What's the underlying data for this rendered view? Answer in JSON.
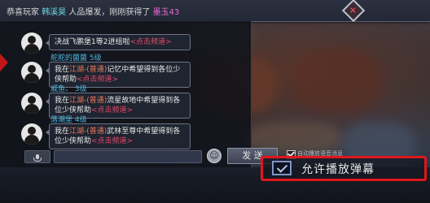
{
  "announcement": {
    "prefix": "恭喜玩家",
    "player": "韩溪昊",
    "middle": "人品爆发，刚刚获得了",
    "item": "墨玉43"
  },
  "chat": {
    "messages": [
      {
        "name": "",
        "text": "决战飞鹏堡1等2进组啦",
        "link": "<点击频道>"
      },
      {
        "name": "舵舵的菌菌 5级",
        "pre": "我在",
        "loc": "江湖-(普通)",
        "post": "记忆中希望得到各位少侠帮助",
        "link": "<点击频道>"
      },
      {
        "name": "戚鱼、 3级",
        "pre": "我在",
        "loc": "江湖-(普通)",
        "post": "流星故地中希望得到各位少侠帮助",
        "link": "<点击频道>"
      },
      {
        "name": "落潮堡 4级",
        "pre": "我在",
        "loc": "江湖-(普通)",
        "post": "武林至尊中希望得到各位少侠帮助",
        "link": "<点击频道>"
      }
    ]
  },
  "input": {
    "send_label": "发 送",
    "emoji_icon": "☺"
  },
  "options": {
    "small_label": "自动播放语音消息",
    "danmaku_label": "允许播放弹幕",
    "danmaku_checked": true
  },
  "colors": {
    "highlight": "#e0161d",
    "name": "#4fb5e0",
    "link": "#e84a6a"
  }
}
